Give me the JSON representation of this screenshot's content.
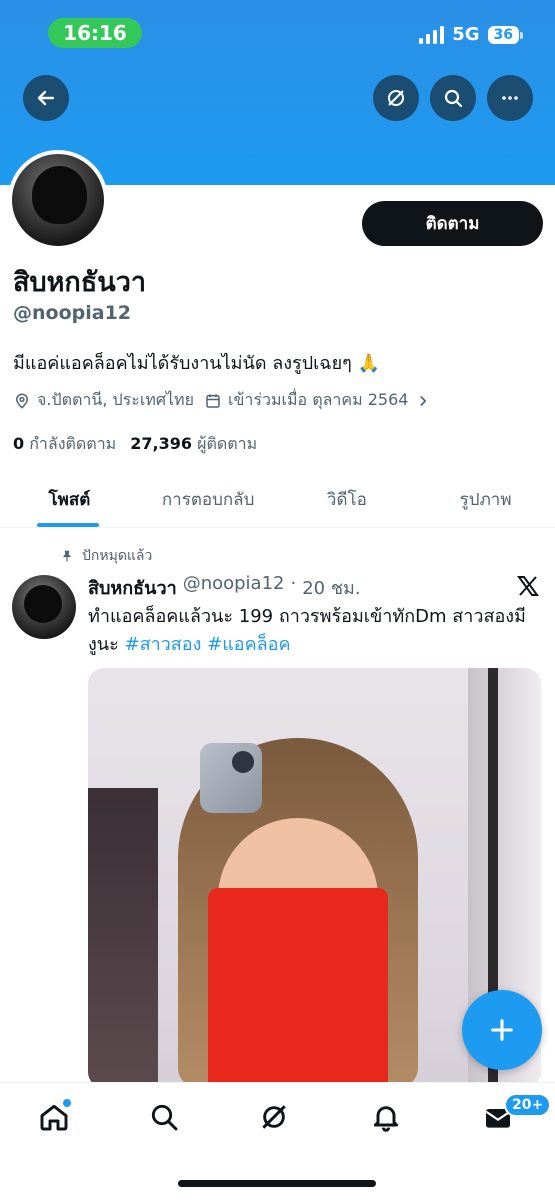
{
  "status": {
    "time": "16:16",
    "network": "5G",
    "battery": "36"
  },
  "profile": {
    "display_name": "สิบหกธันวา",
    "handle": "@noopia12",
    "follow_label": "ติดตาม",
    "bio": "มีแอค่แอคล็อคไม่ได้รับงานไม่นัด ลงรูปเฉยๆ 🙏",
    "location": "จ.ปัตตานี, ประเทศไทย",
    "joined": "เข้าร่วมเมื่อ ตุลาคม 2564",
    "following_count": "0",
    "following_label": "กำลังติดตาม",
    "followers_count": "27,396",
    "followers_label": "ผู้ติดตาม"
  },
  "tabs": [
    {
      "label": "โพสต์"
    },
    {
      "label": "การตอบกลับ"
    },
    {
      "label": "วิดีโอ"
    },
    {
      "label": "รูปภาพ"
    }
  ],
  "post": {
    "pinned_label": "ปักหมุดแล้ว",
    "author_name": "สิบหกธันวา",
    "author_handle": "@noopia12",
    "separator": "·",
    "time": "20 ชม.",
    "text": "ทำแอคล็อคแล้วนะ 199 ถาวรพร้อมเข้าทักDm สาวสองมีงูนะ",
    "hashtags": [
      "#สาวสอง",
      "#แอคล็อค"
    ]
  },
  "nav": {
    "messages_badge": "20+"
  },
  "colors": {
    "accent": "#1d9bf0",
    "text": "#0f1419",
    "muted": "#536471"
  }
}
